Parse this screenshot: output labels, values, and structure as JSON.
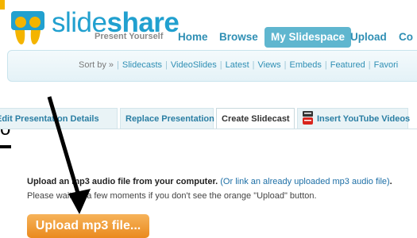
{
  "brand": {
    "name_light": "slide",
    "name_bold": "share",
    "tagline": "Present Yourself",
    "color": "#21a0cf"
  },
  "topnav": {
    "items": [
      "Home",
      "Browse",
      "My Slidespace",
      "Upload",
      "Co"
    ],
    "active": "My Slidespace"
  },
  "sortbar": {
    "label": "Sort by »",
    "links": [
      "Slidecasts",
      "VideoSlides",
      "Latest",
      "Views",
      "Embeds",
      "Featured",
      "Favori"
    ]
  },
  "tabs": [
    {
      "label": "Edit Presentation Details"
    },
    {
      "label": "Replace Presentation"
    },
    {
      "label": "Create Slidecast",
      "active": true
    },
    {
      "label": "Insert YouTube Videos",
      "icon": "youtube-icon"
    }
  ],
  "left_text": "o",
  "content": {
    "line1_bold": "Upload an mp3 audio file from your computer.",
    "line1_link": "(Or link an already uploaded mp3 audio file)",
    "line1_end": ".",
    "line2": "Please wait for a few moments if you don't see the orange \"Upload\" button.",
    "button_label": "Upload mp3 file..."
  },
  "colors": {
    "accent": "#21a0cf",
    "nav_active_bg": "#5fb6cf",
    "button_orange": "#ea8a1e",
    "arrow": "#000000"
  }
}
